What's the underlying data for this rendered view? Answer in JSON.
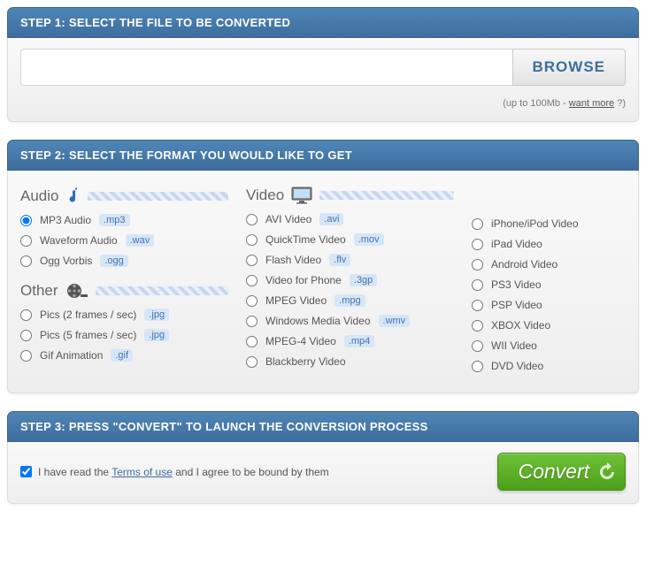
{
  "step1": {
    "header": "STEP 1: SELECT THE FILE TO BE CONVERTED",
    "browse": "BROWSE",
    "hint_prefix": "(up to 100Mb - ",
    "hint_link": "want more",
    "hint_suffix": " ?)"
  },
  "step2": {
    "header": "STEP 2: SELECT THE FORMAT YOU WOULD LIKE TO GET",
    "cat_audio": "Audio",
    "cat_video": "Video",
    "cat_other": "Other",
    "audio": [
      {
        "label": "MP3 Audio",
        "ext": ".mp3",
        "checked": true
      },
      {
        "label": "Waveform Audio",
        "ext": ".wav",
        "checked": false
      },
      {
        "label": "Ogg Vorbis",
        "ext": ".ogg",
        "checked": false
      }
    ],
    "other": [
      {
        "label": "Pics (2 frames / sec)",
        "ext": ".jpg",
        "checked": false
      },
      {
        "label": "Pics (5 frames / sec)",
        "ext": ".jpg",
        "checked": false
      },
      {
        "label": "Gif Animation",
        "ext": ".gif",
        "checked": false
      }
    ],
    "video_mid": [
      {
        "label": "AVI Video",
        "ext": ".avi",
        "checked": false
      },
      {
        "label": "QuickTime Video",
        "ext": ".mov",
        "checked": false
      },
      {
        "label": "Flash Video",
        "ext": ".flv",
        "checked": false
      },
      {
        "label": "Video for Phone",
        "ext": ".3gp",
        "checked": false
      },
      {
        "label": "MPEG Video",
        "ext": ".mpg",
        "checked": false
      },
      {
        "label": "Windows Media Video",
        "ext": ".wmv",
        "checked": false
      },
      {
        "label": "MPEG-4 Video",
        "ext": ".mp4",
        "checked": false
      },
      {
        "label": "Blackberry Video",
        "ext": "",
        "checked": false
      }
    ],
    "video_right": [
      {
        "label": "iPhone/iPod Video",
        "ext": "",
        "checked": false
      },
      {
        "label": "iPad Video",
        "ext": "",
        "checked": false
      },
      {
        "label": "Android Video",
        "ext": "",
        "checked": false
      },
      {
        "label": "PS3 Video",
        "ext": "",
        "checked": false
      },
      {
        "label": "PSP Video",
        "ext": "",
        "checked": false
      },
      {
        "label": "XBOX Video",
        "ext": "",
        "checked": false
      },
      {
        "label": "WII Video",
        "ext": "",
        "checked": false
      },
      {
        "label": "DVD Video",
        "ext": "",
        "checked": false
      }
    ]
  },
  "step3": {
    "header": "STEP 3: PRESS \"CONVERT\" TO LAUNCH THE CONVERSION PROCESS",
    "terms_prefix": "I have read the ",
    "terms_link": "Terms of use",
    "terms_suffix": " and I agree to be bound by them",
    "terms_checked": true,
    "convert": "Convert"
  }
}
